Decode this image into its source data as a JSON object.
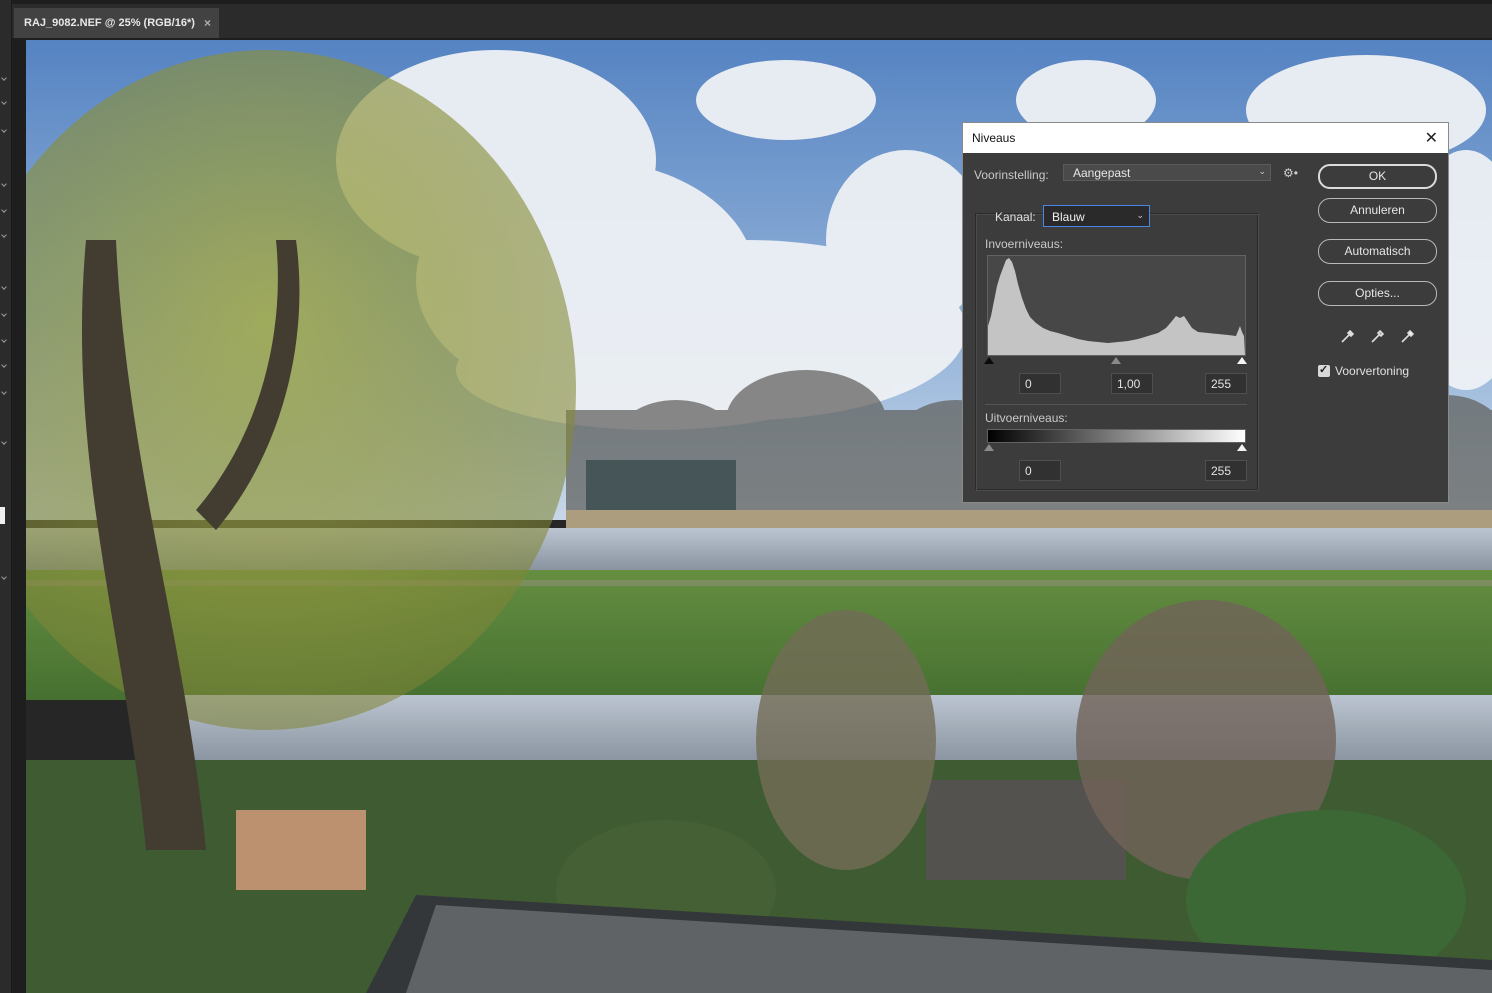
{
  "document": {
    "tab_title": "RAJ_9082.NEF @ 25% (RGB/16*)",
    "tab_close": "×"
  },
  "dialog": {
    "title": "Niveaus",
    "close_glyph": "✕",
    "preset_label": "Voorinstelling:",
    "preset_value": "Aangepast",
    "channel_label": "Kanaal:",
    "channel_value": "Blauw",
    "input_levels_label": "Invoerniveaus:",
    "output_levels_label": "Uitvoerniveaus:",
    "input_black": "0",
    "input_gamma": "1,00",
    "input_white": "255",
    "output_black": "0",
    "output_white": "255",
    "buttons": {
      "ok": "OK",
      "cancel": "Annuleren",
      "auto": "Automatisch",
      "options": "Opties..."
    },
    "preview_label": "Voorvertoning",
    "preview_checked": true,
    "icons": [
      "gear-icon",
      "black-point-eyedropper-icon",
      "gray-point-eyedropper-icon",
      "white-point-eyedropper-icon",
      "chevron-down-icon",
      "checkmark-icon"
    ]
  },
  "colors": {
    "dialog_bg": "#3c3c3c",
    "titlebar_bg": "#ffffff",
    "focus_accent": "#4a86e8",
    "histogram_fill": "#c4c4c4"
  }
}
